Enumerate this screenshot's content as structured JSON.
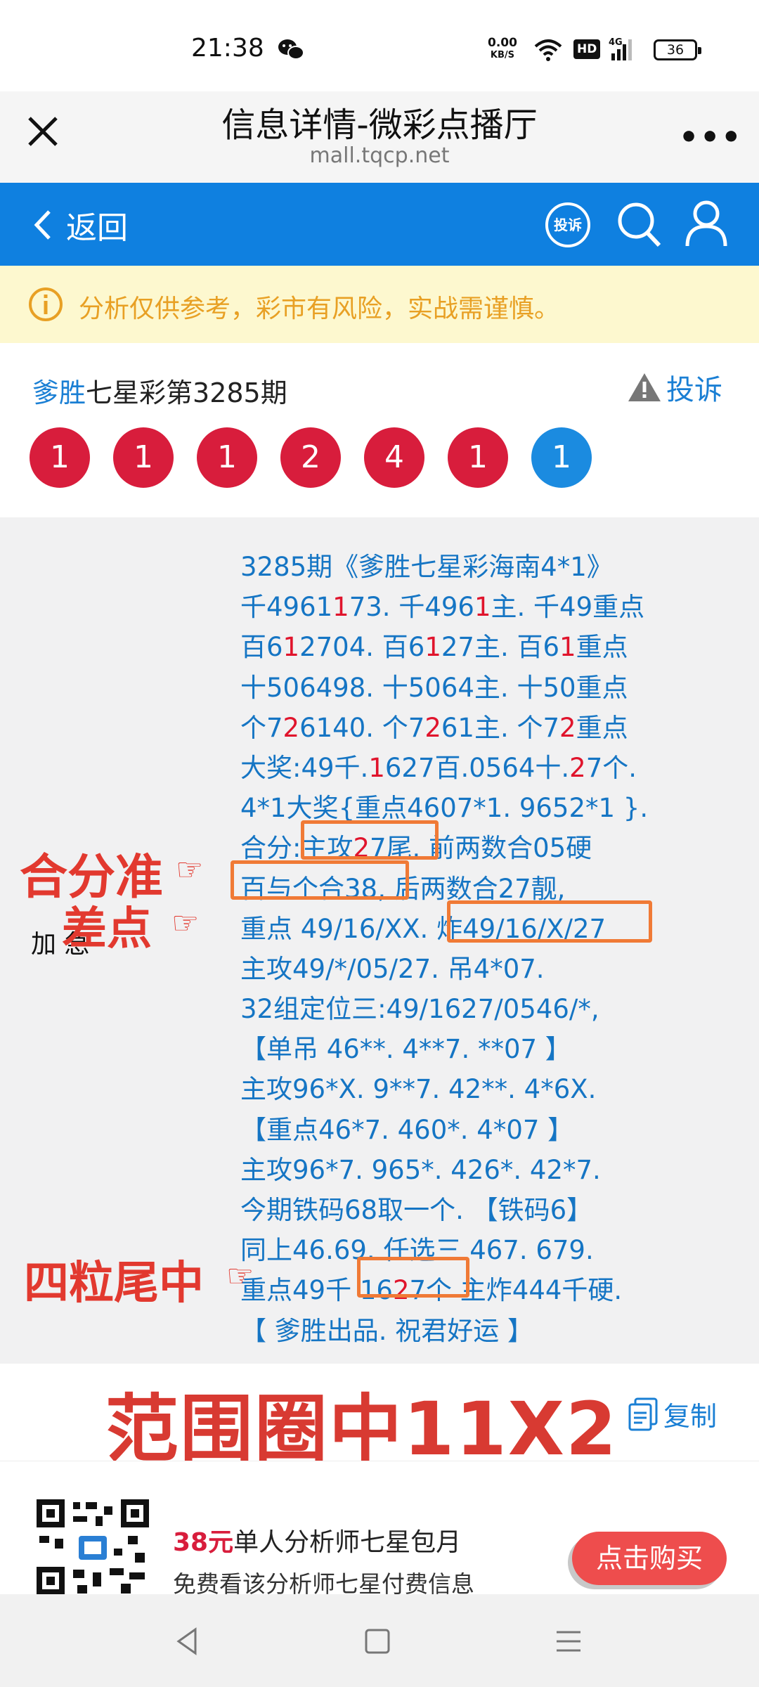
{
  "status_bar": {
    "time": "21:38",
    "net_speed_value": "0.00",
    "net_speed_unit": "KB/S",
    "hd_label": "HD",
    "battery": "36"
  },
  "titlebar": {
    "title": "信息详情-微彩点播厅",
    "url": "mall.tqcp.net",
    "more": "•••"
  },
  "nav": {
    "back_label": "返回",
    "complain_badge": "投诉"
  },
  "warning": {
    "text": "分析仅供参考，彩市有风险，实战需谨慎。"
  },
  "header": {
    "author": "爹胜",
    "issue": "七星彩第3285期",
    "complain_label": "投诉"
  },
  "balls": [
    {
      "value": "1",
      "color": "red"
    },
    {
      "value": "1",
      "color": "red"
    },
    {
      "value": "1",
      "color": "red"
    },
    {
      "value": "2",
      "color": "red"
    },
    {
      "value": "4",
      "color": "red"
    },
    {
      "value": "1",
      "color": "red"
    },
    {
      "value": "1",
      "color": "blue"
    }
  ],
  "content": {
    "lines": [
      [
        {
          "t": "3285期《爹胜七星彩海南4*1》"
        }
      ],
      [
        {
          "t": "千4961"
        },
        {
          "t": "1",
          "r": true
        },
        {
          "t": "73. 千496"
        },
        {
          "t": "1",
          "r": true
        },
        {
          "t": "主. 千49重点"
        }
      ],
      [
        {
          "t": "百6"
        },
        {
          "t": "1",
          "r": true
        },
        {
          "t": "2704. 百6"
        },
        {
          "t": "1",
          "r": true
        },
        {
          "t": "27主. 百6"
        },
        {
          "t": "1",
          "r": true
        },
        {
          "t": "重点"
        }
      ],
      [
        {
          "t": "十506498. 十5064主. 十50重点"
        }
      ],
      [
        {
          "t": "个7"
        },
        {
          "t": "2",
          "r": true
        },
        {
          "t": "6140. 个7"
        },
        {
          "t": "2",
          "r": true
        },
        {
          "t": "61主. 个7"
        },
        {
          "t": "2",
          "r": true
        },
        {
          "t": "重点"
        }
      ],
      [
        {
          "t": "大奖:49千."
        },
        {
          "t": "1",
          "r": true
        },
        {
          "t": "627百.0564十."
        },
        {
          "t": "2",
          "r": true
        },
        {
          "t": "7个."
        }
      ],
      [
        {
          "t": "4*1大奖{重点4607*1. 9652*1 }."
        }
      ],
      [
        {
          "t": "合分:主攻"
        },
        {
          "t": "2",
          "r": true
        },
        {
          "t": "7尾. 前两数合05硬"
        }
      ],
      [
        {
          "t": "百与个合38,  后两数合27靓,"
        }
      ],
      [
        {
          "t": "重点 49/16/XX. 炸49/16/X/27"
        }
      ],
      [
        {
          "t": "主攻49/*/05/27. 吊4*07."
        }
      ],
      [
        {
          "t": "32组定位三:49/1627/0546/*,"
        }
      ],
      [
        {
          "t": "【单吊 46**. 4**7. **07 】"
        }
      ],
      [
        {
          "t": "主攻96*X. 9**7. 42**. 4*6X."
        }
      ],
      [
        {
          "t": "【重点46*7. 460*. 4*07 】"
        }
      ],
      [
        {
          "t": "主攻96*7. 965*. 426*. 42*7."
        }
      ],
      [
        {
          "t": "今期铁码68取一个. 【铁码6】"
        }
      ],
      [
        {
          "t": "同上46.69. 任选三 467. 679."
        }
      ],
      [
        {
          "t": "重点49千 16"
        },
        {
          "t": "2",
          "r": true
        },
        {
          "t": "7个 主炸444千硬."
        }
      ],
      [
        {
          "t": "【 爹胜出品. 祝君好运 】"
        }
      ]
    ],
    "side_text": "加 急",
    "annotations": {
      "a1": "合分准",
      "a2": "差点",
      "a3": "四粒尾中"
    }
  },
  "copy_row": {
    "big_text": "范围圈中11X2",
    "copy_label": "复制"
  },
  "promo": {
    "price": "38元",
    "price_desc": "单人分析师七星包月",
    "sub": "免费看该分析师七星付费信息",
    "buy_label": "点击购买"
  }
}
